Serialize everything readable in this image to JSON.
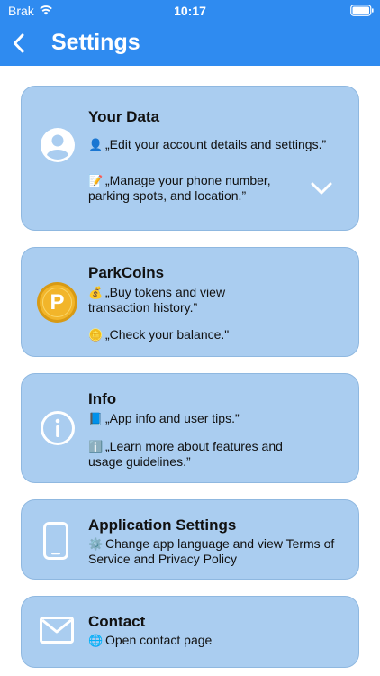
{
  "status_bar": {
    "carrier": "Brak",
    "time": "10:17"
  },
  "header": {
    "title": "Settings",
    "back_icon": "chevron-left-icon"
  },
  "colors": {
    "header_bg": "#2f8bf0",
    "card_bg": "#aacdf0",
    "coin_gold": "#f2b52a"
  },
  "cards": {
    "your_data": {
      "icon": "person-circle-icon",
      "title": "Your Data",
      "line1_emoji": "👤",
      "line1": "„Edit your account details and settings.”",
      "line2_emoji": "📝",
      "line2": "„Manage your phone number, parking spots, and location.”",
      "expand_icon": "chevron-down-icon"
    },
    "parkcoins": {
      "icon": "coin-icon",
      "coin_letter": "P",
      "title": "ParkCoins",
      "line1_emoji": "💰",
      "line1": "„Buy tokens and view transaction history.”",
      "line2_emoji": "🪙",
      "line2": "„Check your balance.\""
    },
    "info": {
      "icon": "info-circle-icon",
      "title": "Info",
      "line1_emoji": "📘",
      "line1": "„App info and user tips.”",
      "line2_emoji": "ℹ️",
      "line2": "„Learn more about features and usage guidelines.”"
    },
    "app_settings": {
      "icon": "phone-icon",
      "title": "Application Settings",
      "line1_emoji": "⚙️",
      "line1": "Change app language and view Terms of Service and Privacy Policy"
    },
    "contact": {
      "icon": "envelope-icon",
      "title": "Contact",
      "line1_emoji": "🌐",
      "line1": "Open contact page"
    }
  }
}
